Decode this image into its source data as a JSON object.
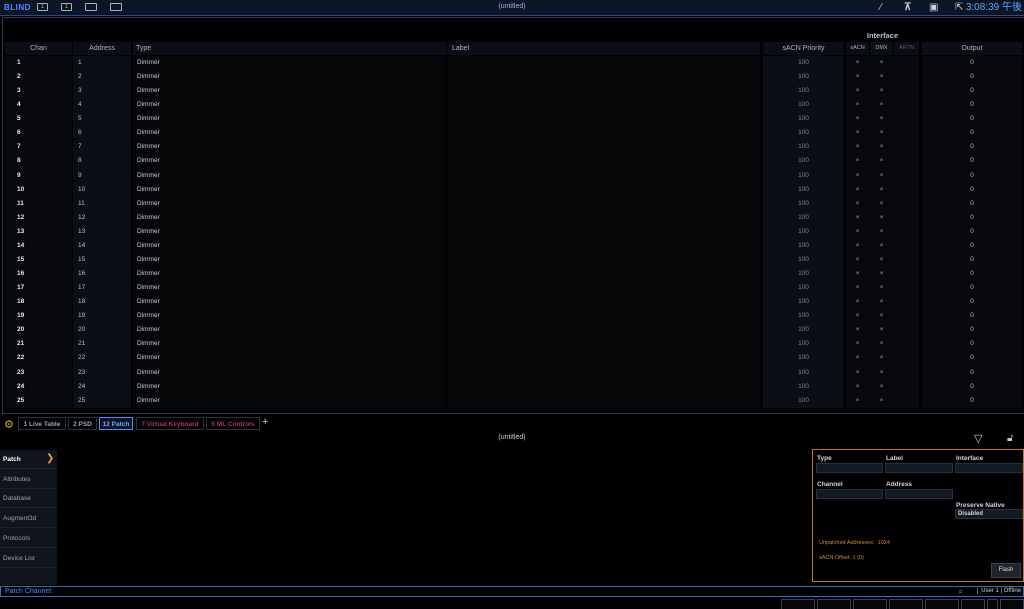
{
  "topbar": {
    "mode": "BLIND",
    "btn1": "1",
    "btn2": "1",
    "title": "(untitled)",
    "time": "3:08:39 午後"
  },
  "table": {
    "group_header": "Interface",
    "columns": {
      "chan": "Chan",
      "address": "Address",
      "type": "Type",
      "label": "Label",
      "priority": "sACN Priority",
      "sacn": "sACN",
      "dmx": "DMX",
      "artn": "ARTN",
      "output": "Output"
    },
    "rows": [
      {
        "chan": "1",
        "address": "1",
        "type": "Dimmer",
        "label": "",
        "priority": "100",
        "sacn": "×",
        "dmx": "×",
        "output": "0"
      },
      {
        "chan": "2",
        "address": "2",
        "type": "Dimmer",
        "label": "",
        "priority": "100",
        "sacn": "×",
        "dmx": "×",
        "output": "0"
      },
      {
        "chan": "3",
        "address": "3",
        "type": "Dimmer",
        "label": "",
        "priority": "100",
        "sacn": "×",
        "dmx": "×",
        "output": "0"
      },
      {
        "chan": "4",
        "address": "4",
        "type": "Dimmer",
        "label": "",
        "priority": "100",
        "sacn": "×",
        "dmx": "×",
        "output": "0"
      },
      {
        "chan": "5",
        "address": "5",
        "type": "Dimmer",
        "label": "",
        "priority": "100",
        "sacn": "×",
        "dmx": "×",
        "output": "0"
      },
      {
        "chan": "6",
        "address": "6",
        "type": "Dimmer",
        "label": "",
        "priority": "100",
        "sacn": "×",
        "dmx": "×",
        "output": "0"
      },
      {
        "chan": "7",
        "address": "7",
        "type": "Dimmer",
        "label": "",
        "priority": "100",
        "sacn": "×",
        "dmx": "×",
        "output": "0"
      },
      {
        "chan": "8",
        "address": "8",
        "type": "Dimmer",
        "label": "",
        "priority": "100",
        "sacn": "×",
        "dmx": "×",
        "output": "0"
      },
      {
        "chan": "9",
        "address": "9",
        "type": "Dimmer",
        "label": "",
        "priority": "100",
        "sacn": "×",
        "dmx": "×",
        "output": "0"
      },
      {
        "chan": "10",
        "address": "10",
        "type": "Dimmer",
        "label": "",
        "priority": "100",
        "sacn": "×",
        "dmx": "×",
        "output": "0"
      },
      {
        "chan": "11",
        "address": "11",
        "type": "Dimmer",
        "label": "",
        "priority": "100",
        "sacn": "×",
        "dmx": "×",
        "output": "0"
      },
      {
        "chan": "12",
        "address": "12",
        "type": "Dimmer",
        "label": "",
        "priority": "100",
        "sacn": "×",
        "dmx": "×",
        "output": "0"
      },
      {
        "chan": "13",
        "address": "13",
        "type": "Dimmer",
        "label": "",
        "priority": "100",
        "sacn": "×",
        "dmx": "×",
        "output": "0"
      },
      {
        "chan": "14",
        "address": "14",
        "type": "Dimmer",
        "label": "",
        "priority": "100",
        "sacn": "×",
        "dmx": "×",
        "output": "0"
      },
      {
        "chan": "15",
        "address": "15",
        "type": "Dimmer",
        "label": "",
        "priority": "100",
        "sacn": "×",
        "dmx": "×",
        "output": "0"
      },
      {
        "chan": "16",
        "address": "16",
        "type": "Dimmer",
        "label": "",
        "priority": "100",
        "sacn": "×",
        "dmx": "×",
        "output": "0"
      },
      {
        "chan": "17",
        "address": "17",
        "type": "Dimmer",
        "label": "",
        "priority": "100",
        "sacn": "×",
        "dmx": "×",
        "output": "0"
      },
      {
        "chan": "18",
        "address": "18",
        "type": "Dimmer",
        "label": "",
        "priority": "100",
        "sacn": "×",
        "dmx": "×",
        "output": "0"
      },
      {
        "chan": "19",
        "address": "19",
        "type": "Dimmer",
        "label": "",
        "priority": "100",
        "sacn": "×",
        "dmx": "×",
        "output": "0"
      },
      {
        "chan": "20",
        "address": "20",
        "type": "Dimmer",
        "label": "",
        "priority": "100",
        "sacn": "×",
        "dmx": "×",
        "output": "0"
      },
      {
        "chan": "21",
        "address": "21",
        "type": "Dimmer",
        "label": "",
        "priority": "100",
        "sacn": "×",
        "dmx": "×",
        "output": "0"
      },
      {
        "chan": "22",
        "address": "22",
        "type": "Dimmer",
        "label": "",
        "priority": "100",
        "sacn": "×",
        "dmx": "×",
        "output": "0"
      },
      {
        "chan": "23",
        "address": "23",
        "type": "Dimmer",
        "label": "",
        "priority": "100",
        "sacn": "×",
        "dmx": "×",
        "output": "0"
      },
      {
        "chan": "24",
        "address": "24",
        "type": "Dimmer",
        "label": "",
        "priority": "100",
        "sacn": "×",
        "dmx": "×",
        "output": "0"
      },
      {
        "chan": "25",
        "address": "25",
        "type": "Dimmer",
        "label": "",
        "priority": "100",
        "sacn": "×",
        "dmx": "×",
        "output": "0"
      }
    ]
  },
  "tabs": [
    {
      "label": "1 Live Table",
      "color": "#9aa3b2",
      "active": false
    },
    {
      "label": "2 PSD",
      "color": "#9aa3b2",
      "active": false
    },
    {
      "label": "12 Patch",
      "color": "#6aa8ff",
      "active": true
    },
    {
      "label": "7 Virtual Keyboard",
      "color": "#b0306a",
      "active": false
    },
    {
      "label": "5 ML Controls",
      "color": "#b0306a",
      "active": false
    }
  ],
  "patch": {
    "subtitle": "(untitled)",
    "sidebar": [
      {
        "label": "Patch",
        "active": true
      },
      {
        "label": "Attributes",
        "active": false
      },
      {
        "label": "Database",
        "active": false
      },
      {
        "label": "Augment3d",
        "active": false
      },
      {
        "label": "Protocols",
        "active": false
      },
      {
        "label": "Device List",
        "active": false
      }
    ],
    "form": {
      "type_label": "Type",
      "label_label": "Label",
      "interface_label": "Interface",
      "channel_label": "Channel",
      "address_label": "Address",
      "preserve_label": "Preserve Native",
      "preserve_value": "Disabled",
      "unpatched": "Unpatched Addresses: -1024",
      "sacn_offset": "sACN Offset: 1 (0)",
      "flash": "Flash"
    }
  },
  "cmdline": {
    "prompt": "Patch Channel:",
    "user": "User 1 | Offline"
  },
  "colors": {
    "accent": "#4d8bff",
    "warn": "#c6781e",
    "bg": "#000000"
  }
}
